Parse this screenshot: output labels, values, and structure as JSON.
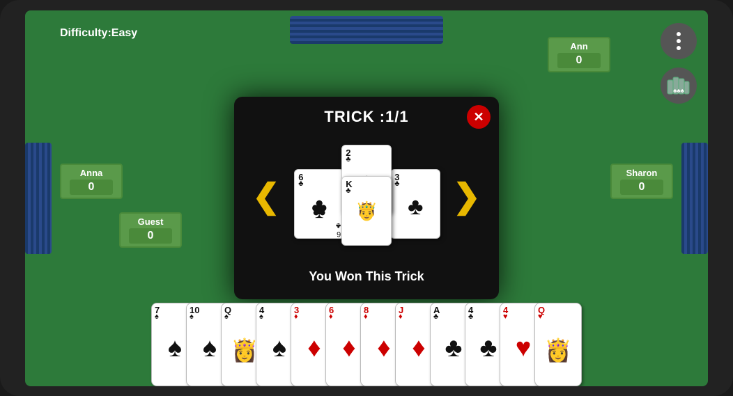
{
  "difficulty": {
    "label": "Difficulty:Easy"
  },
  "players": {
    "ann": {
      "name": "Ann",
      "score": "0"
    },
    "anna": {
      "name": "Anna",
      "score": "0"
    },
    "guest": {
      "name": "Guest",
      "score": "0"
    },
    "sharon": {
      "name": "Sharon",
      "score": "0"
    }
  },
  "modal": {
    "title": "TRICK :1/1",
    "close_label": "✕",
    "win_text": "You Won This Trick",
    "nav_left": "❮",
    "nav_right": "❯"
  },
  "trick_cards": [
    {
      "rank": "6",
      "suit": "♣",
      "color": "black",
      "position": "left"
    },
    {
      "rank": "2",
      "suit": "♣",
      "color": "black",
      "position": "top"
    },
    {
      "rank": "3",
      "suit": "♣",
      "color": "black",
      "position": "right"
    },
    {
      "rank": "K",
      "suit": "♣",
      "color": "black",
      "position": "bottom"
    }
  ],
  "hand_cards": [
    {
      "rank": "7",
      "suit": "♠",
      "color": "black"
    },
    {
      "rank": "10",
      "suit": "♠",
      "color": "black"
    },
    {
      "rank": "Q",
      "suit": "♠",
      "color": "black"
    },
    {
      "rank": "4",
      "suit": "♠",
      "color": "black"
    },
    {
      "rank": "3",
      "suit": "♦",
      "color": "red"
    },
    {
      "rank": "6",
      "suit": "♦",
      "color": "red"
    },
    {
      "rank": "8",
      "suit": "♦",
      "color": "red"
    },
    {
      "rank": "J",
      "suit": "♦",
      "color": "red"
    },
    {
      "rank": "A",
      "suit": "♣",
      "color": "black"
    },
    {
      "rank": "4",
      "suit": "♣",
      "color": "black"
    },
    {
      "rank": "4",
      "suit": "♥",
      "color": "red"
    },
    {
      "rank": "Q",
      "suit": "♥",
      "color": "red"
    }
  ],
  "buttons": {
    "menu_dots": "⋮",
    "hand_icon": "🂠"
  }
}
